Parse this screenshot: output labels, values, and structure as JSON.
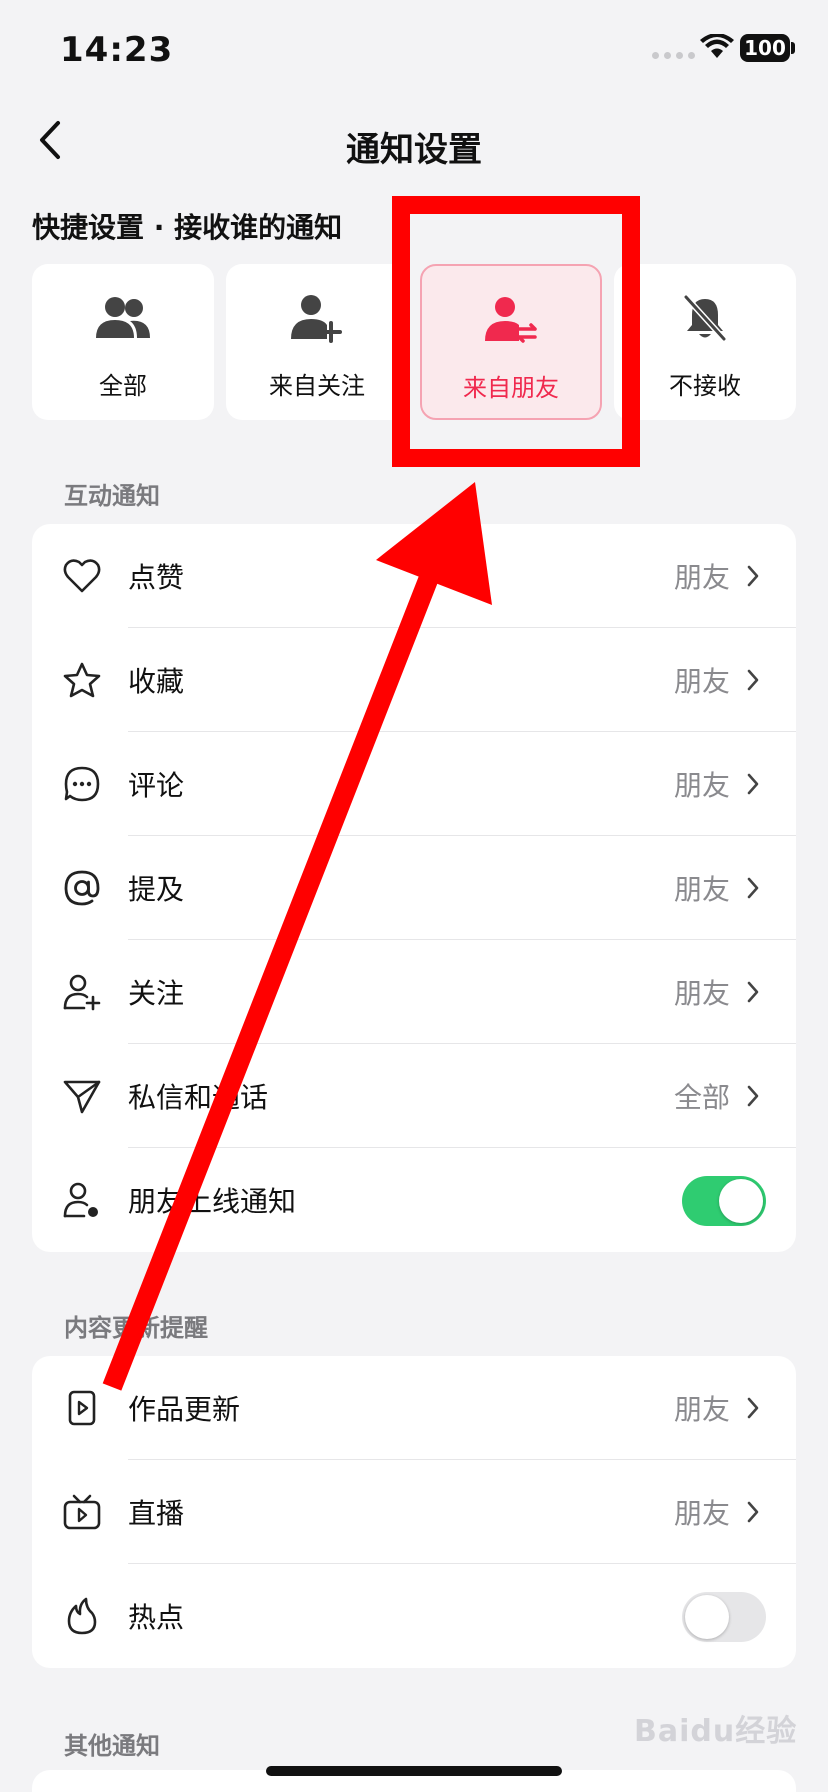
{
  "status_bar": {
    "time": "14:23",
    "battery": "100"
  },
  "header": {
    "title": "通知设置"
  },
  "quick_settings": {
    "title": "快捷设置 · 接收谁的通知",
    "options": [
      {
        "label": "全部",
        "icon": "group-icon",
        "selected": false
      },
      {
        "label": "来自关注",
        "icon": "user-plus-icon",
        "selected": false
      },
      {
        "label": "来自朋友",
        "icon": "user-swap-icon",
        "selected": true
      },
      {
        "label": "不接收",
        "icon": "bell-off-icon",
        "selected": false
      }
    ]
  },
  "interaction": {
    "title": "互动通知",
    "items": [
      {
        "label": "点赞",
        "value": "朋友",
        "icon": "heart-icon"
      },
      {
        "label": "收藏",
        "value": "朋友",
        "icon": "star-icon"
      },
      {
        "label": "评论",
        "value": "朋友",
        "icon": "comment-icon"
      },
      {
        "label": "提及",
        "value": "朋友",
        "icon": "at-icon"
      },
      {
        "label": "关注",
        "value": "朋友",
        "icon": "user-add-icon"
      },
      {
        "label": "私信和通话",
        "value": "全部",
        "icon": "send-icon"
      },
      {
        "label": "朋友上线通知",
        "toggle": true,
        "icon": "user-online-icon"
      }
    ]
  },
  "content_updates": {
    "title": "内容更新提醒",
    "items": [
      {
        "label": "作品更新",
        "value": "朋友",
        "icon": "video-icon"
      },
      {
        "label": "直播",
        "value": "朋友",
        "icon": "tv-icon"
      },
      {
        "label": "热点",
        "toggle": false,
        "icon": "flame-icon"
      }
    ]
  },
  "other": {
    "title": "其他通知"
  },
  "watermark": "Baidu经验",
  "colors": {
    "accent": "#f0294e",
    "toggle_on": "#2fcc71",
    "annotation": "#ff0000",
    "background": "#f3f3f5"
  }
}
